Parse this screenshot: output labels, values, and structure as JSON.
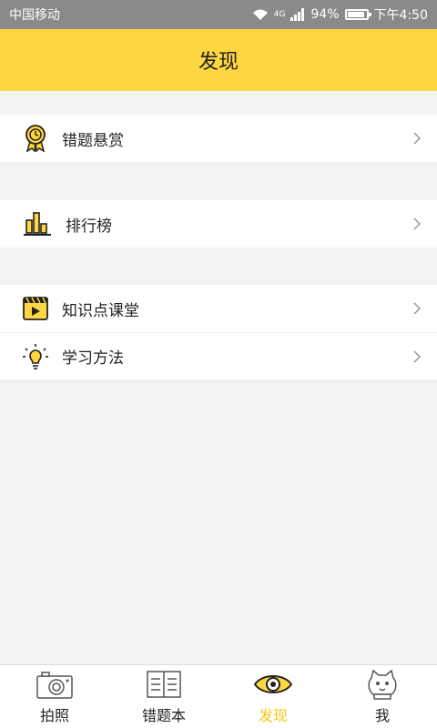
{
  "status": {
    "carrier": "中国移动",
    "network": "4G",
    "battery": "94%",
    "time": "下午4:50"
  },
  "header": {
    "title": "发现"
  },
  "groups": [
    {
      "items": [
        {
          "label": "错题悬赏",
          "icon": "award-ribbon-icon"
        }
      ]
    },
    {
      "items": [
        {
          "label": "排行榜",
          "icon": "bar-chart-icon"
        }
      ]
    },
    {
      "items": [
        {
          "label": "知识点课堂",
          "icon": "video-play-icon"
        },
        {
          "label": "学习方法",
          "icon": "lightbulb-icon"
        }
      ]
    }
  ],
  "tabs": [
    {
      "label": "拍照",
      "icon": "camera-icon"
    },
    {
      "label": "错题本",
      "icon": "book-icon"
    },
    {
      "label": "发现",
      "icon": "eye-icon",
      "active": true
    },
    {
      "label": "我",
      "icon": "cat-avatar-icon"
    }
  ],
  "colors": {
    "accent": "#fed642",
    "active_tab": "#f6c814",
    "background": "#f2f2f2"
  }
}
